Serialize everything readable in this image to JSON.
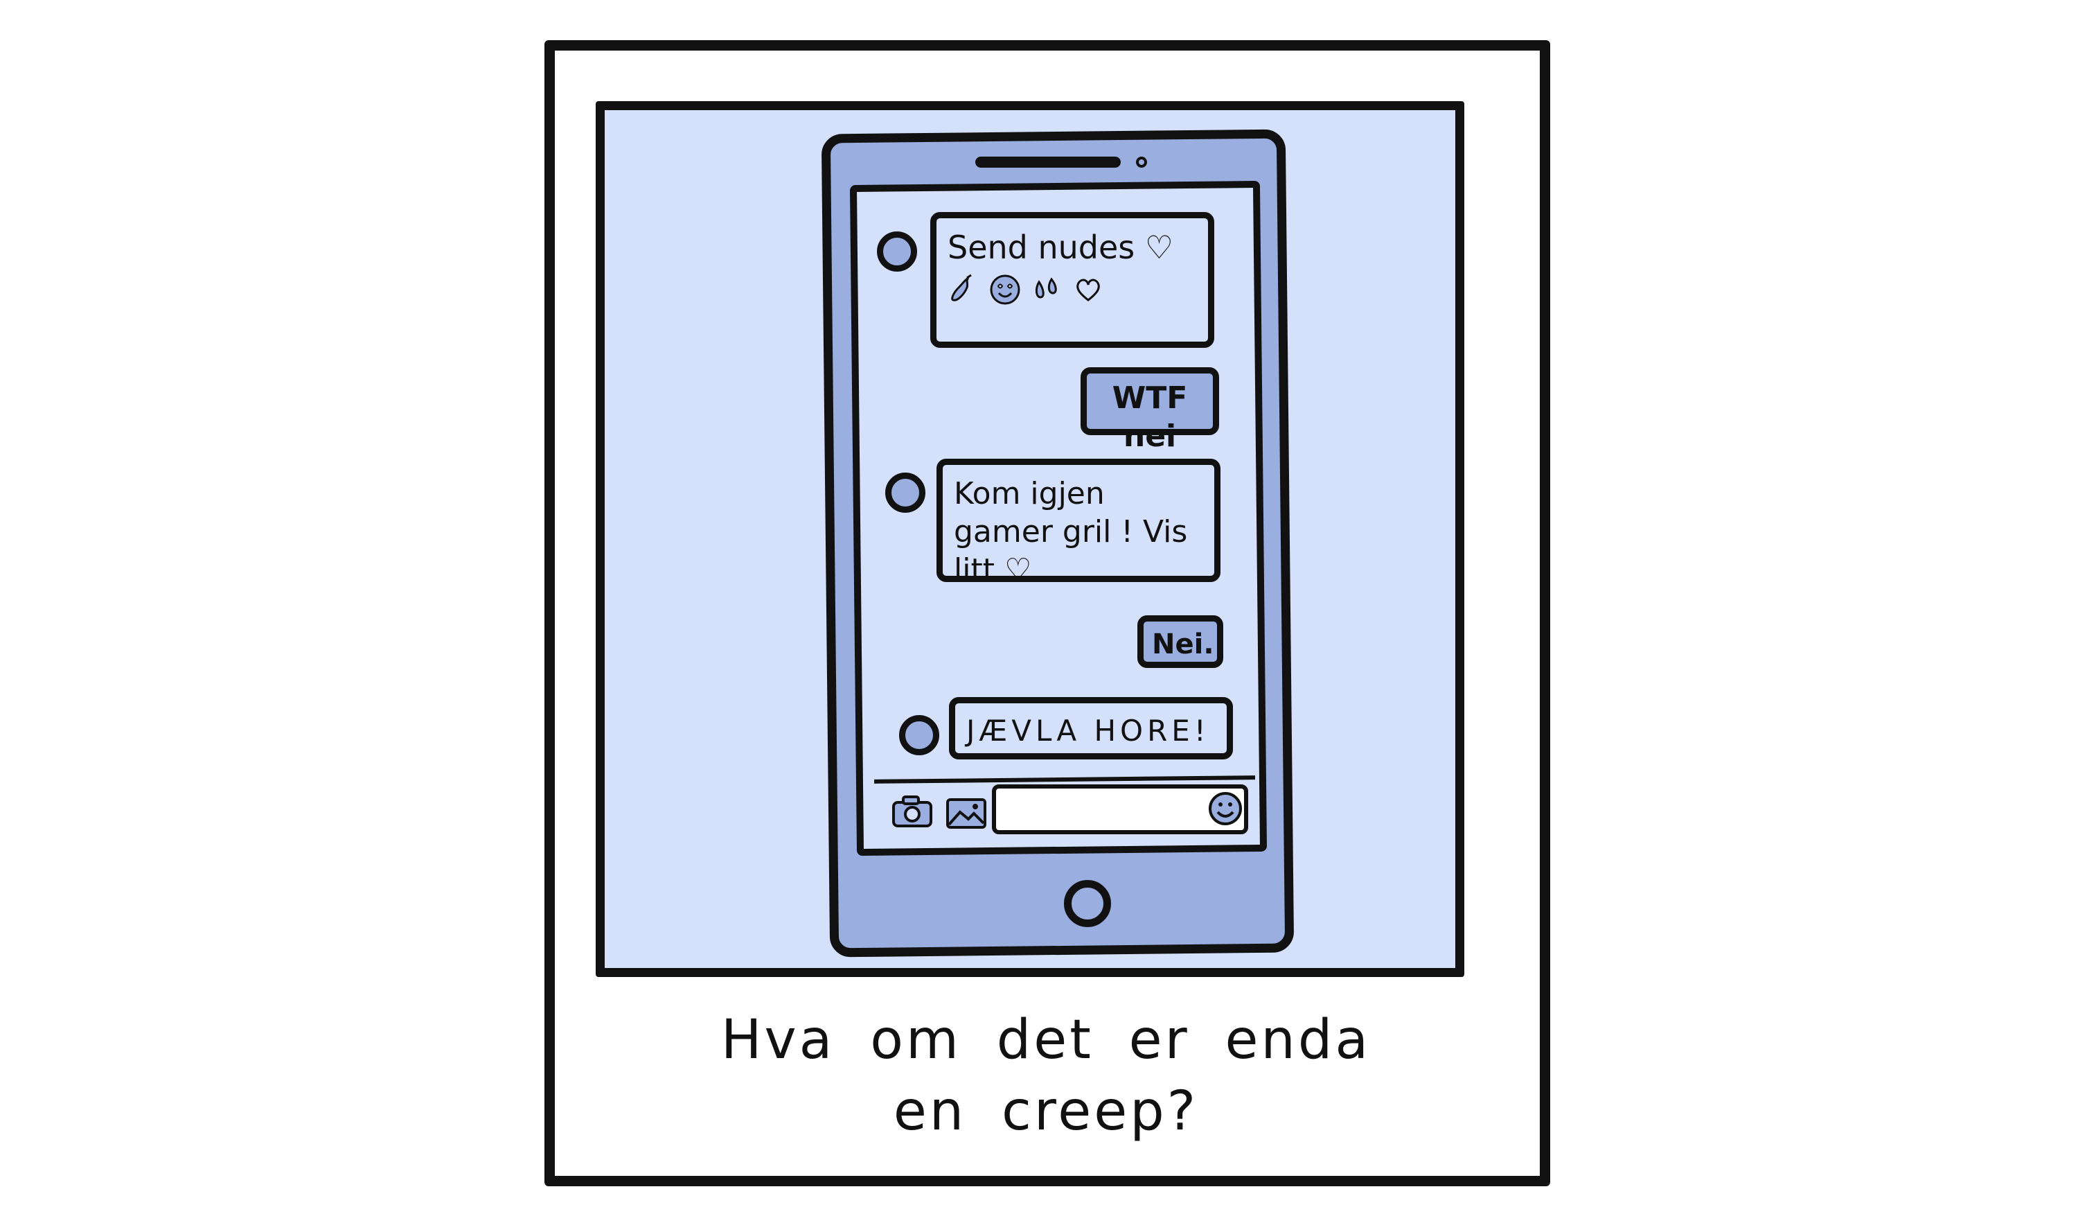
{
  "colors": {
    "background": "#ffffff",
    "photo_background": "#d5e1fb",
    "phone_body": "#9aaee0",
    "outline": "#111111"
  },
  "chat": {
    "messages": [
      {
        "sender": "other",
        "text": "Send nudes ♡",
        "emojis": [
          "eggplant-icon",
          "heart-eyes-icon",
          "drops-icon",
          "heart-icon"
        ]
      },
      {
        "sender": "me",
        "text": "WTF nei"
      },
      {
        "sender": "other",
        "text": "Kom igjen gamer gril ! Vis litt ♡"
      },
      {
        "sender": "me",
        "text": "Nei."
      },
      {
        "sender": "other",
        "text": "JÆVLA HORE!"
      }
    ]
  },
  "input_bar": {
    "icons": [
      "camera-icon",
      "gallery-icon",
      "smiley-icon"
    ]
  },
  "caption": "Hva om det er enda en creep?"
}
